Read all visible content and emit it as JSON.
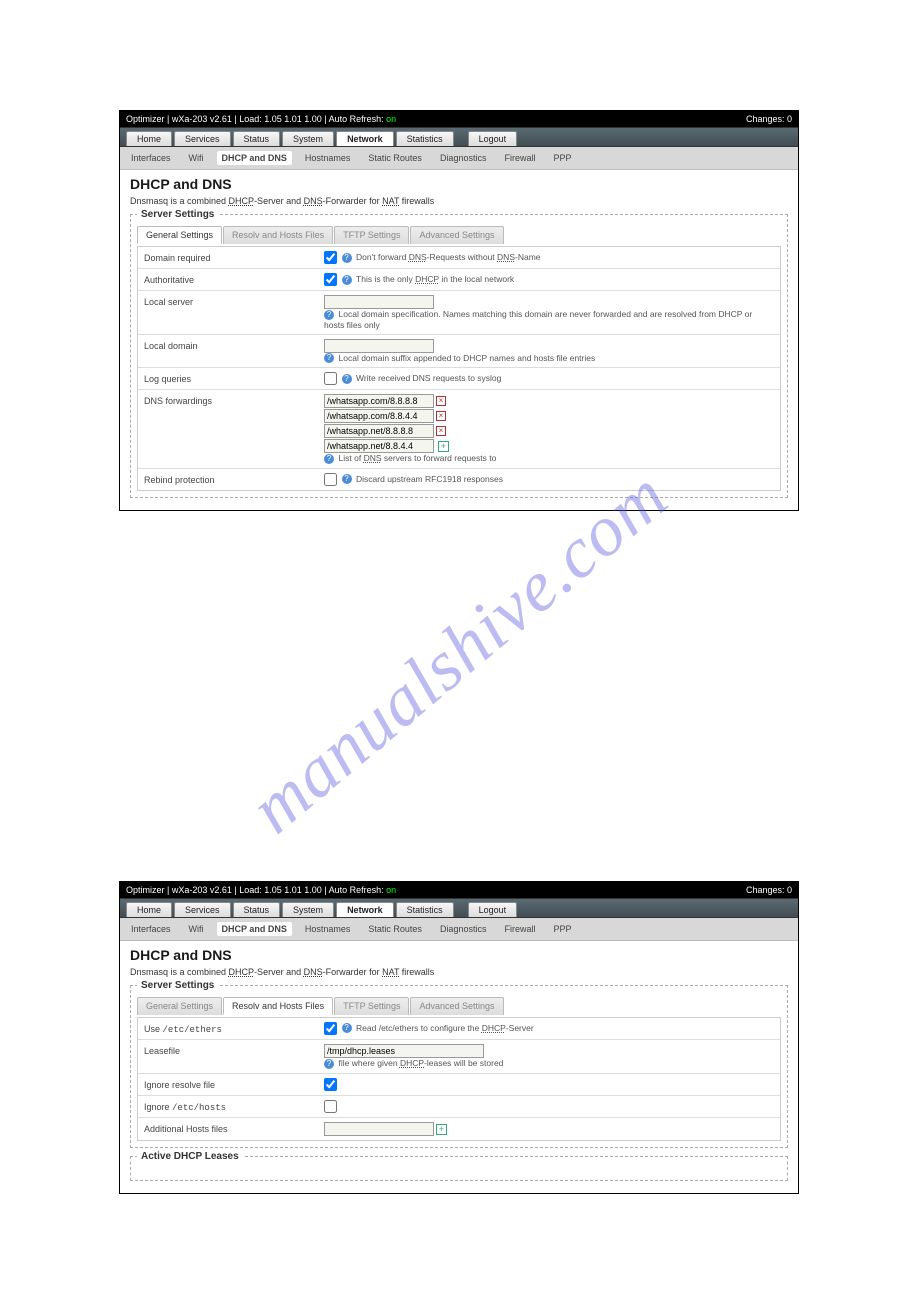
{
  "watermark": "manualshive.com",
  "topbar": {
    "left_prefix": "Optimizer | wXa-203 v2.61 | Load: 1.05 1.01 1.00 | Auto Refresh: ",
    "on": "on",
    "right": "Changes: 0"
  },
  "mainTabs": [
    "Home",
    "Services",
    "Status",
    "System",
    "Network",
    "Statistics",
    "Logout"
  ],
  "mainTabActive": "Network",
  "subTabs": [
    "Interfaces",
    "Wifi",
    "DHCP and DNS",
    "Hostnames",
    "Static Routes",
    "Diagnostics",
    "Firewall",
    "PPP"
  ],
  "subTabActive": "DHCP and DNS",
  "pageTitle": "DHCP and DNS",
  "pageDesc": {
    "p1": "Dnsmasq is a combined ",
    "p2": "DHCP",
    "p3": "-Server and ",
    "p4": "DNS",
    "p5": "-Forwarder for ",
    "p6": "NAT",
    "p7": " firewalls"
  },
  "legend": "Server Settings",
  "innerTabs": [
    "General Settings",
    "Resolv and Hosts Files",
    "TFTP Settings",
    "Advanced Settings"
  ],
  "shot1": {
    "activeInner": "General Settings",
    "rows": {
      "domainRequired": {
        "label": "Domain required",
        "checked": true,
        "hint_pre": "Don't forward ",
        "hint_u1": "DNS",
        "hint_mid": "-Requests without ",
        "hint_u2": "DNS",
        "hint_post": "-Name"
      },
      "authoritative": {
        "label": "Authoritative",
        "checked": true,
        "hint_pre": "This is the only ",
        "hint_u": "DHCP",
        "hint_post": " in the local network"
      },
      "localServer": {
        "label": "Local server",
        "value": "",
        "hint": "Local domain specification. Names matching this domain are never forwarded and are resolved from DHCP or hosts files only"
      },
      "localDomain": {
        "label": "Local domain",
        "value": "",
        "hint": "Local domain suffix appended to DHCP names and hosts file entries"
      },
      "logQueries": {
        "label": "Log queries",
        "checked": false,
        "hint": "Write received DNS requests to syslog"
      },
      "dnsFwd": {
        "label": "DNS forwardings",
        "entries": [
          "/whatsapp.com/8.8.8.8",
          "/whatsapp.com/8.8.4.4",
          "/whatsapp.net/8.8.8.8",
          "/whatsapp.net/8.8.4.4"
        ],
        "hint_pre": "List of ",
        "hint_u": "DNS",
        "hint_post": " servers to forward requests to"
      },
      "rebind": {
        "label": "Rebind protection",
        "checked": false,
        "hint": "Discard upstream RFC1918 responses"
      }
    }
  },
  "shot2": {
    "activeInner": "Resolv and Hosts Files",
    "rows": {
      "useEthers": {
        "label_pre": "Use ",
        "label_mono": "/etc/ethers",
        "checked": true,
        "hint_pre": "Read ",
        "hint_mono": "/etc/ethers",
        "hint_mid": " to configure the ",
        "hint_u": "DHCP",
        "hint_post": "-Server"
      },
      "leasefile": {
        "label": "Leasefile",
        "value": "/tmp/dhcp.leases",
        "hint_pre": "file where given ",
        "hint_u": "DHCP",
        "hint_post": "-leases will be stored"
      },
      "ignoreResolve": {
        "label": "Ignore resolve file",
        "checked": true
      },
      "ignoreHosts": {
        "label_pre": "Ignore ",
        "label_mono": "/etc/hosts",
        "checked": false
      },
      "additionalHosts": {
        "label": "Additional Hosts files",
        "value": ""
      }
    },
    "bottomLegend": "Active DHCP Leases"
  }
}
